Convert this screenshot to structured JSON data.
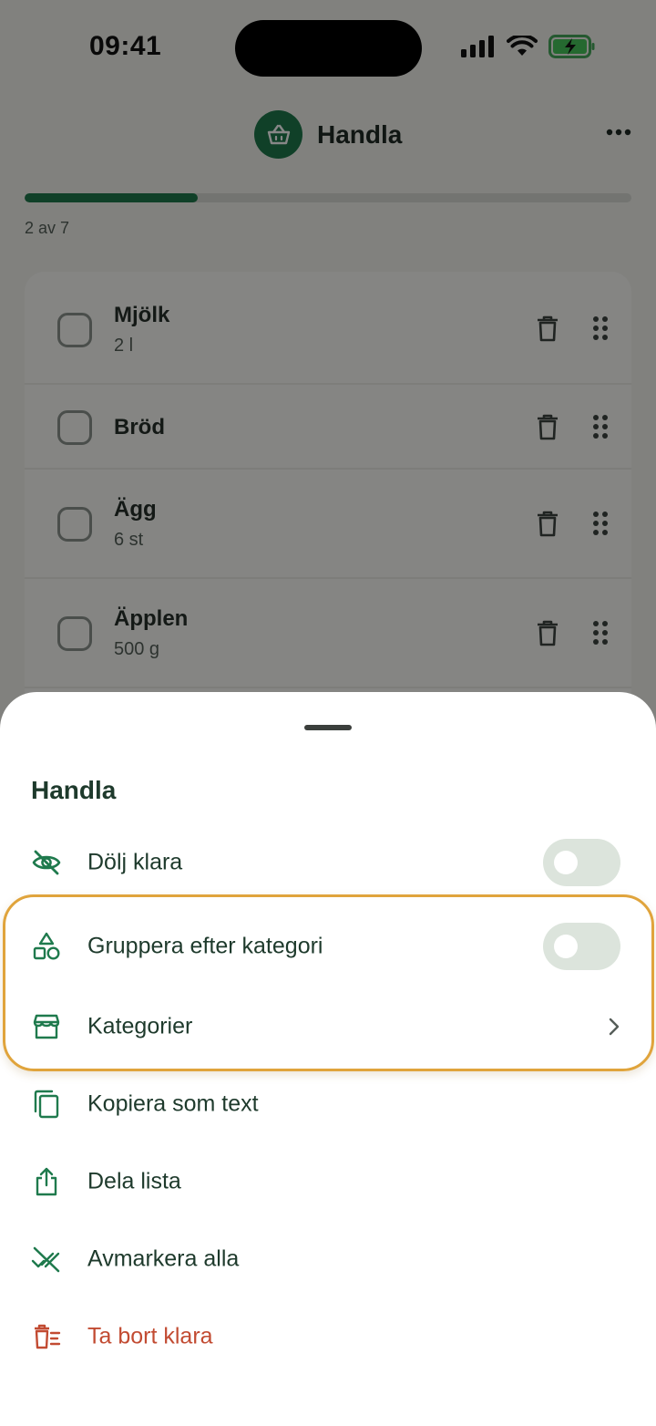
{
  "status_bar": {
    "time": "09:41"
  },
  "header": {
    "title": "Handla",
    "list_icon": "basket-icon",
    "more_icon": "more-horizontal-icon"
  },
  "progress": {
    "text": "2 av 7",
    "fraction": 0.2857
  },
  "items": [
    {
      "name": "Mjölk",
      "quantity": "2 l"
    },
    {
      "name": "Bröd",
      "quantity": ""
    },
    {
      "name": "Ägg",
      "quantity": "6 st"
    },
    {
      "name": "Äpplen",
      "quantity": "500 g"
    }
  ],
  "sheet": {
    "title": "Handla",
    "options": [
      {
        "label": "Dölj klara",
        "icon": "eye-off-icon",
        "control": "toggle",
        "on": false
      },
      {
        "label": "Gruppera efter kategori",
        "icon": "shapes-icon",
        "control": "toggle",
        "on": false
      },
      {
        "label": "Kategorier",
        "icon": "store-icon",
        "control": "chevron"
      },
      {
        "label": "Kopiera som text",
        "icon": "copy-icon"
      },
      {
        "label": "Dela lista",
        "icon": "share-icon"
      },
      {
        "label": "Avmarkera alla",
        "icon": "uncheck-all-icon"
      },
      {
        "label": "Ta bort klara",
        "icon": "delete-completed-icon",
        "danger": true
      }
    ]
  },
  "colors": {
    "primary": "#1f7a4d",
    "danger": "#c24b32",
    "highlight": "#e0a43c",
    "text": "#1e3a2c"
  }
}
